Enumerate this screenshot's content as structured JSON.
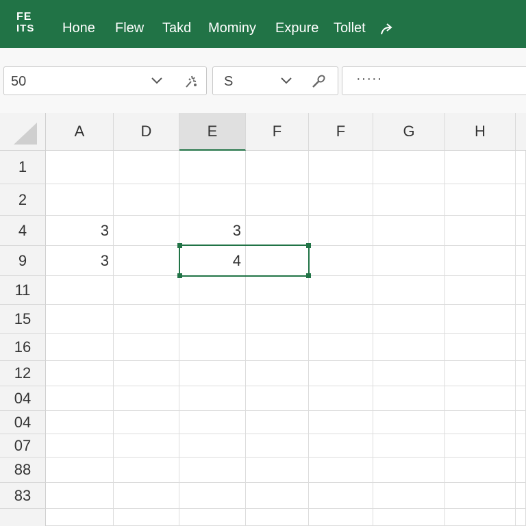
{
  "app": {
    "logo_line1": "FE",
    "logo_line2": "ITS"
  },
  "menu": [
    "Hone",
    "Flew",
    "Takd",
    "Mominy",
    "Expure",
    "Tollet"
  ],
  "toolbar": {
    "name_box_value": "50",
    "font_box_value": "S",
    "formula_box_value": "·····"
  },
  "grid": {
    "columns": [
      "A",
      "D",
      "E",
      "F",
      "F",
      "G",
      "H"
    ],
    "active_column": "E",
    "rows": [
      "1",
      "2",
      "4",
      "9",
      "11",
      "15",
      "16",
      "12",
      "04",
      "04",
      "07",
      "88",
      "83"
    ],
    "cells": {
      "r2c0": "3",
      "r2c2": "3",
      "r3c0": "3",
      "r3c2": "4"
    }
  },
  "colors": {
    "accent": "#217346"
  },
  "icons": [
    "share-icon",
    "chevron-down-icon",
    "sparkle-icon",
    "brush-icon",
    "select-all-icon"
  ]
}
